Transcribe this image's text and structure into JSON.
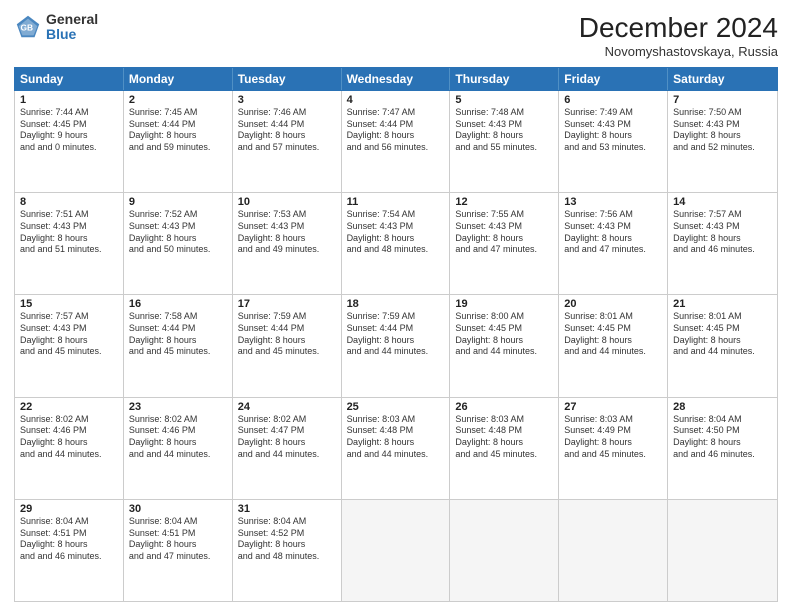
{
  "header": {
    "logo_general": "General",
    "logo_blue": "Blue",
    "month_title": "December 2024",
    "location": "Novomyshastovskaya, Russia"
  },
  "weekdays": [
    "Sunday",
    "Monday",
    "Tuesday",
    "Wednesday",
    "Thursday",
    "Friday",
    "Saturday"
  ],
  "rows": [
    [
      {
        "day": "1",
        "sunrise": "Sunrise: 7:44 AM",
        "sunset": "Sunset: 4:45 PM",
        "daylight": "Daylight: 9 hours and 0 minutes."
      },
      {
        "day": "2",
        "sunrise": "Sunrise: 7:45 AM",
        "sunset": "Sunset: 4:44 PM",
        "daylight": "Daylight: 8 hours and 59 minutes."
      },
      {
        "day": "3",
        "sunrise": "Sunrise: 7:46 AM",
        "sunset": "Sunset: 4:44 PM",
        "daylight": "Daylight: 8 hours and 57 minutes."
      },
      {
        "day": "4",
        "sunrise": "Sunrise: 7:47 AM",
        "sunset": "Sunset: 4:44 PM",
        "daylight": "Daylight: 8 hours and 56 minutes."
      },
      {
        "day": "5",
        "sunrise": "Sunrise: 7:48 AM",
        "sunset": "Sunset: 4:43 PM",
        "daylight": "Daylight: 8 hours and 55 minutes."
      },
      {
        "day": "6",
        "sunrise": "Sunrise: 7:49 AM",
        "sunset": "Sunset: 4:43 PM",
        "daylight": "Daylight: 8 hours and 53 minutes."
      },
      {
        "day": "7",
        "sunrise": "Sunrise: 7:50 AM",
        "sunset": "Sunset: 4:43 PM",
        "daylight": "Daylight: 8 hours and 52 minutes."
      }
    ],
    [
      {
        "day": "8",
        "sunrise": "Sunrise: 7:51 AM",
        "sunset": "Sunset: 4:43 PM",
        "daylight": "Daylight: 8 hours and 51 minutes."
      },
      {
        "day": "9",
        "sunrise": "Sunrise: 7:52 AM",
        "sunset": "Sunset: 4:43 PM",
        "daylight": "Daylight: 8 hours and 50 minutes."
      },
      {
        "day": "10",
        "sunrise": "Sunrise: 7:53 AM",
        "sunset": "Sunset: 4:43 PM",
        "daylight": "Daylight: 8 hours and 49 minutes."
      },
      {
        "day": "11",
        "sunrise": "Sunrise: 7:54 AM",
        "sunset": "Sunset: 4:43 PM",
        "daylight": "Daylight: 8 hours and 48 minutes."
      },
      {
        "day": "12",
        "sunrise": "Sunrise: 7:55 AM",
        "sunset": "Sunset: 4:43 PM",
        "daylight": "Daylight: 8 hours and 47 minutes."
      },
      {
        "day": "13",
        "sunrise": "Sunrise: 7:56 AM",
        "sunset": "Sunset: 4:43 PM",
        "daylight": "Daylight: 8 hours and 47 minutes."
      },
      {
        "day": "14",
        "sunrise": "Sunrise: 7:57 AM",
        "sunset": "Sunset: 4:43 PM",
        "daylight": "Daylight: 8 hours and 46 minutes."
      }
    ],
    [
      {
        "day": "15",
        "sunrise": "Sunrise: 7:57 AM",
        "sunset": "Sunset: 4:43 PM",
        "daylight": "Daylight: 8 hours and 45 minutes."
      },
      {
        "day": "16",
        "sunrise": "Sunrise: 7:58 AM",
        "sunset": "Sunset: 4:44 PM",
        "daylight": "Daylight: 8 hours and 45 minutes."
      },
      {
        "day": "17",
        "sunrise": "Sunrise: 7:59 AM",
        "sunset": "Sunset: 4:44 PM",
        "daylight": "Daylight: 8 hours and 45 minutes."
      },
      {
        "day": "18",
        "sunrise": "Sunrise: 7:59 AM",
        "sunset": "Sunset: 4:44 PM",
        "daylight": "Daylight: 8 hours and 44 minutes."
      },
      {
        "day": "19",
        "sunrise": "Sunrise: 8:00 AM",
        "sunset": "Sunset: 4:45 PM",
        "daylight": "Daylight: 8 hours and 44 minutes."
      },
      {
        "day": "20",
        "sunrise": "Sunrise: 8:01 AM",
        "sunset": "Sunset: 4:45 PM",
        "daylight": "Daylight: 8 hours and 44 minutes."
      },
      {
        "day": "21",
        "sunrise": "Sunrise: 8:01 AM",
        "sunset": "Sunset: 4:45 PM",
        "daylight": "Daylight: 8 hours and 44 minutes."
      }
    ],
    [
      {
        "day": "22",
        "sunrise": "Sunrise: 8:02 AM",
        "sunset": "Sunset: 4:46 PM",
        "daylight": "Daylight: 8 hours and 44 minutes."
      },
      {
        "day": "23",
        "sunrise": "Sunrise: 8:02 AM",
        "sunset": "Sunset: 4:46 PM",
        "daylight": "Daylight: 8 hours and 44 minutes."
      },
      {
        "day": "24",
        "sunrise": "Sunrise: 8:02 AM",
        "sunset": "Sunset: 4:47 PM",
        "daylight": "Daylight: 8 hours and 44 minutes."
      },
      {
        "day": "25",
        "sunrise": "Sunrise: 8:03 AM",
        "sunset": "Sunset: 4:48 PM",
        "daylight": "Daylight: 8 hours and 44 minutes."
      },
      {
        "day": "26",
        "sunrise": "Sunrise: 8:03 AM",
        "sunset": "Sunset: 4:48 PM",
        "daylight": "Daylight: 8 hours and 45 minutes."
      },
      {
        "day": "27",
        "sunrise": "Sunrise: 8:03 AM",
        "sunset": "Sunset: 4:49 PM",
        "daylight": "Daylight: 8 hours and 45 minutes."
      },
      {
        "day": "28",
        "sunrise": "Sunrise: 8:04 AM",
        "sunset": "Sunset: 4:50 PM",
        "daylight": "Daylight: 8 hours and 46 minutes."
      }
    ],
    [
      {
        "day": "29",
        "sunrise": "Sunrise: 8:04 AM",
        "sunset": "Sunset: 4:51 PM",
        "daylight": "Daylight: 8 hours and 46 minutes."
      },
      {
        "day": "30",
        "sunrise": "Sunrise: 8:04 AM",
        "sunset": "Sunset: 4:51 PM",
        "daylight": "Daylight: 8 hours and 47 minutes."
      },
      {
        "day": "31",
        "sunrise": "Sunrise: 8:04 AM",
        "sunset": "Sunset: 4:52 PM",
        "daylight": "Daylight: 8 hours and 48 minutes."
      },
      null,
      null,
      null,
      null
    ]
  ]
}
